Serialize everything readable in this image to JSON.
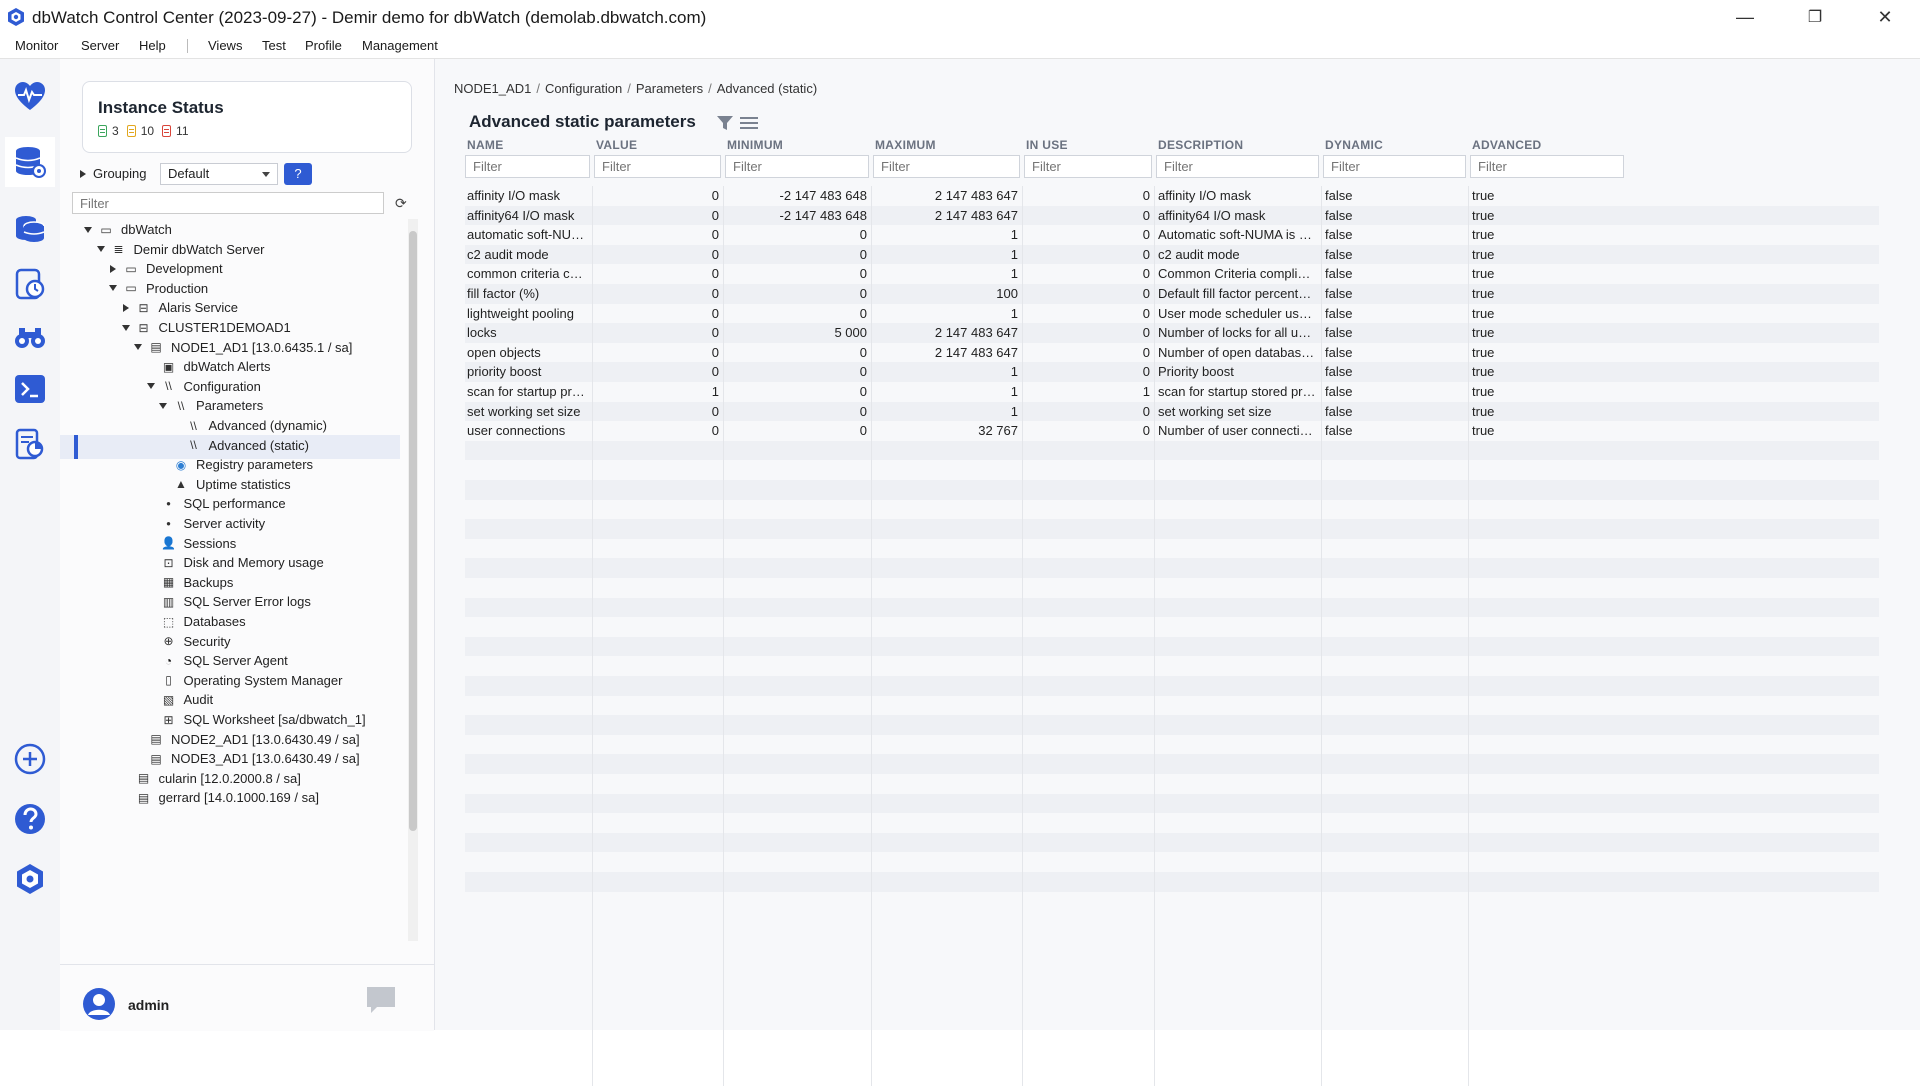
{
  "window": {
    "title": "dbWatch Control Center  (2023-09-27) - Demir demo for dbWatch (demolab.dbwatch.com)",
    "controls": [
      "—",
      "❐",
      "✕"
    ]
  },
  "menu": {
    "left": [
      "Monitor",
      "Server",
      "Help"
    ],
    "right": [
      "Views",
      "Test",
      "Profile",
      "Management"
    ]
  },
  "leftbar": {
    "icons": [
      "heartbeat-icon",
      "database-settings-icon",
      "database-stack-icon",
      "database-clock-icon",
      "binoculars-icon",
      "terminal-icon",
      "report-icon",
      "add-icon",
      "help-icon",
      "settings-hex-icon"
    ]
  },
  "instance_status": {
    "title": "Instance Status",
    "counts": [
      {
        "value": "3",
        "color": "#3ba55c"
      },
      {
        "value": "10",
        "color": "#e2a71e"
      },
      {
        "value": "11",
        "color": "#d9453a"
      }
    ]
  },
  "grouping": {
    "label": "Grouping",
    "value": "Default",
    "help": "?"
  },
  "tree_filter_placeholder": "Filter",
  "tree": [
    {
      "label": "dbWatch",
      "level": 0,
      "tog": "down",
      "icon": "folder-icon"
    },
    {
      "label": "Demir dbWatch Server",
      "level": 1,
      "tog": "down",
      "icon": "server-icon"
    },
    {
      "label": "Development",
      "level": 2,
      "tog": "right",
      "icon": "folder-icon"
    },
    {
      "label": "Production",
      "level": 2,
      "tog": "down",
      "icon": "folder-icon"
    },
    {
      "label": "Alaris Service",
      "level": 3,
      "tog": "right",
      "icon": "cluster-icon"
    },
    {
      "label": "CLUSTER1DEMOAD1",
      "level": 3,
      "tog": "down",
      "icon": "cluster-icon"
    },
    {
      "label": "NODE1_AD1 [13.0.6435.1 / sa]",
      "level": 4,
      "tog": "down",
      "icon": "database-icon"
    },
    {
      "label": "dbWatch Alerts",
      "level": 5,
      "tog": "",
      "icon": "alerts-icon"
    },
    {
      "label": "Configuration",
      "level": 5,
      "tog": "down",
      "icon": "config-icon"
    },
    {
      "label": "Parameters",
      "level": 6,
      "tog": "down",
      "icon": "config-icon"
    },
    {
      "label": "Advanced (dynamic)",
      "level": 7,
      "tog": "",
      "icon": "config-icon"
    },
    {
      "label": "Advanced (static)",
      "level": 7,
      "tog": "",
      "icon": "config-icon",
      "selected": true
    },
    {
      "label": "Registry parameters",
      "level": 6,
      "tog": "",
      "icon": "registry-icon"
    },
    {
      "label": "Uptime statistics",
      "level": 6,
      "tog": "",
      "icon": "uptime-icon"
    },
    {
      "label": "SQL performance",
      "level": 5,
      "tog": "",
      "icon": "dot-icon"
    },
    {
      "label": "Server activity",
      "level": 5,
      "tog": "",
      "icon": "dot-icon"
    },
    {
      "label": "Sessions",
      "level": 5,
      "tog": "",
      "icon": "user-icon"
    },
    {
      "label": "Disk and Memory usage",
      "level": 5,
      "tog": "",
      "icon": "disk-icon"
    },
    {
      "label": "Backups",
      "level": 5,
      "tog": "",
      "icon": "backup-icon"
    },
    {
      "label": "SQL Server Error logs",
      "level": 5,
      "tog": "",
      "icon": "log-icon"
    },
    {
      "label": "Databases",
      "level": 5,
      "tog": "",
      "icon": "databases-icon"
    },
    {
      "label": "Security",
      "level": 5,
      "tog": "",
      "icon": "globe-icon"
    },
    {
      "label": "SQL Server Agent",
      "level": 5,
      "tog": "",
      "icon": "agent-icon"
    },
    {
      "label": "Operating System Manager",
      "level": 5,
      "tog": "",
      "icon": "os-icon"
    },
    {
      "label": "Audit",
      "level": 5,
      "tog": "",
      "icon": "audit-icon"
    },
    {
      "label": "SQL Worksheet [sa/dbwatch_1]",
      "level": 5,
      "tog": "",
      "icon": "worksheet-icon"
    },
    {
      "label": "NODE2_AD1 [13.0.6430.49 / sa]",
      "level": 4,
      "tog": "",
      "icon": "database-icon"
    },
    {
      "label": "NODE3_AD1 [13.0.6430.49 / sa]",
      "level": 4,
      "tog": "",
      "icon": "database-icon"
    },
    {
      "label": "cularin [12.0.2000.8 / sa]",
      "level": 3,
      "tog": "",
      "icon": "database-icon"
    },
    {
      "label": "gerrard [14.0.1000.169 / sa]",
      "level": 3,
      "tog": "",
      "icon": "database-icon"
    }
  ],
  "user": {
    "name": "admin"
  },
  "breadcrumb": [
    "NODE1_AD1",
    "Configuration",
    "Parameters",
    "Advanced (static)"
  ],
  "page_title": "Advanced static parameters",
  "table": {
    "columns": [
      "NAME",
      "VALUE",
      "MINIMUM",
      "MAXIMUM",
      "IN USE",
      "DESCRIPTION",
      "DYNAMIC",
      "ADVANCED"
    ],
    "filter_placeholder": "Filter",
    "rows": [
      [
        "affinity I/O mask",
        "0",
        "-2 147 483 648",
        "2 147 483 647",
        "0",
        "affinity I/O mask",
        "false",
        "true"
      ],
      [
        "affinity64 I/O mask",
        "0",
        "-2 147 483 648",
        "2 147 483 647",
        "0",
        "affinity64 I/O mask",
        "false",
        "true"
      ],
      [
        "automatic soft-NUMA ...",
        "0",
        "0",
        "1",
        "0",
        "Automatic soft-NUMA is enabl...",
        "false",
        "true"
      ],
      [
        "c2 audit mode",
        "0",
        "0",
        "1",
        "0",
        "c2 audit mode",
        "false",
        "true"
      ],
      [
        "common criteria compl...",
        "0",
        "0",
        "1",
        "0",
        "Common Criteria compliance ...",
        "false",
        "true"
      ],
      [
        "fill factor (%)",
        "0",
        "0",
        "100",
        "0",
        "Default fill factor percentage",
        "false",
        "true"
      ],
      [
        "lightweight pooling",
        "0",
        "0",
        "1",
        "0",
        "User mode scheduler uses ligh...",
        "false",
        "true"
      ],
      [
        "locks",
        "0",
        "5 000",
        "2 147 483 647",
        "0",
        "Number of locks for all users",
        "false",
        "true"
      ],
      [
        "open objects",
        "0",
        "0",
        "2 147 483 647",
        "0",
        "Number of open database obje...",
        "false",
        "true"
      ],
      [
        "priority boost",
        "0",
        "0",
        "1",
        "0",
        "Priority boost",
        "false",
        "true"
      ],
      [
        "scan for startup procs",
        "1",
        "0",
        "1",
        "1",
        "scan for startup stored proced...",
        "false",
        "true"
      ],
      [
        "set working set size",
        "0",
        "0",
        "1",
        "0",
        "set working set size",
        "false",
        "true"
      ],
      [
        "user connections",
        "0",
        "0",
        "32 767",
        "0",
        "Number of user connections all...",
        "false",
        "true"
      ]
    ]
  }
}
